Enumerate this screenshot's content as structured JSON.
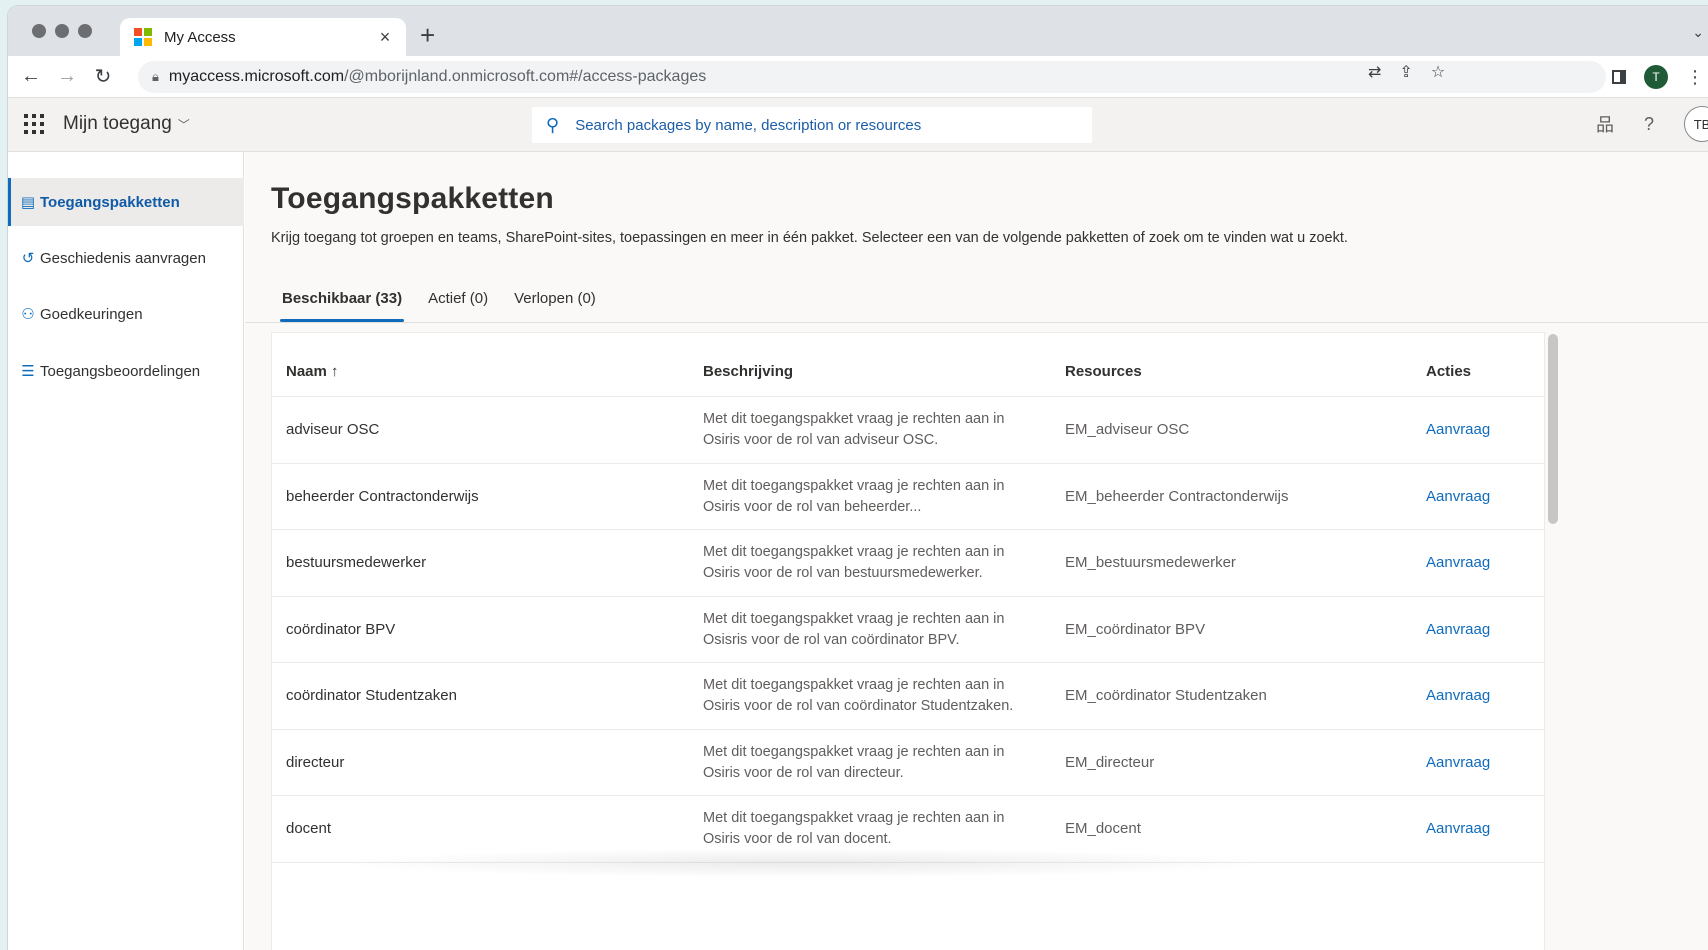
{
  "browser": {
    "tab_title": "My Access",
    "tab_close": "×",
    "new_tab": "+",
    "url_host": "myaccess.microsoft.com",
    "url_path": "/@mborijnland.onmicrosoft.com#/access-packages",
    "profile_initial": "T"
  },
  "app": {
    "name": "Mijn toegang",
    "search_placeholder": "Search packages by name, description or resources",
    "avatar_initials": "TB"
  },
  "nav": {
    "items": [
      {
        "label": "Toegangspakketten",
        "icon": "package-icon",
        "active": true
      },
      {
        "label": "Geschiedenis aanvragen",
        "icon": "history-icon",
        "active": false
      },
      {
        "label": "Goedkeuringen",
        "icon": "person-add-icon",
        "active": false
      },
      {
        "label": "Toegangsbeoordelingen",
        "icon": "checklist-icon",
        "active": false
      }
    ]
  },
  "main": {
    "title": "Toegangspakketten",
    "description": "Krijg toegang tot groepen en teams, SharePoint-sites, toepassingen en meer in één pakket. Selecteer een van de volgende pakketten of zoek om te vinden wat u zoekt.",
    "tabs": [
      {
        "label": "Beschikbaar (33)",
        "active": true
      },
      {
        "label": "Actief (0)",
        "active": false
      },
      {
        "label": "Verlopen (0)",
        "active": false
      }
    ]
  },
  "table": {
    "headers": {
      "name": "Naam ↑",
      "description": "Beschrijving",
      "resources": "Resources",
      "actions": "Acties"
    },
    "rows": [
      {
        "name": "adviseur OSC",
        "description": "Met dit toegangspakket vraag je rechten aan in Osiris voor de rol van adviseur OSC.",
        "resources": "EM_adviseur OSC",
        "action": "Aanvraag"
      },
      {
        "name": "beheerder Contractonderwijs",
        "description": "Met dit toegangspakket vraag je rechten aan in Osiris voor de rol van beheerder...",
        "resources": "EM_beheerder Contractonderwijs",
        "action": "Aanvraag"
      },
      {
        "name": "bestuursmedewerker",
        "description": "Met dit toegangspakket vraag je rechten aan in Osiris voor de rol van bestuursmedewerker.",
        "resources": "EM_bestuursmedewerker",
        "action": "Aanvraag"
      },
      {
        "name": "coördinator BPV",
        "description": "Met dit toegangspakket vraag je rechten aan in Osisris voor de rol van coördinator BPV.",
        "resources": "EM_coördinator BPV",
        "action": "Aanvraag"
      },
      {
        "name": "coördinator Studentzaken",
        "description": "Met dit toegangspakket vraag je rechten aan in Osiris voor de rol van coördinator Studentzaken.",
        "resources": "EM_coördinator Studentzaken",
        "action": "Aanvraag"
      },
      {
        "name": "directeur",
        "description": "Met dit toegangspakket vraag je rechten aan in Osiris voor de rol van directeur.",
        "resources": "EM_directeur",
        "action": "Aanvraag"
      },
      {
        "name": "docent",
        "description": "Met dit toegangspakket vraag je rechten aan in Osiris voor de rol van docent.",
        "resources": "EM_docent",
        "action": "Aanvraag"
      }
    ]
  },
  "colors": {
    "accent": "#0f6cbd",
    "ms_logo": [
      "#f25022",
      "#7fba00",
      "#00a4ef",
      "#ffb900"
    ]
  }
}
